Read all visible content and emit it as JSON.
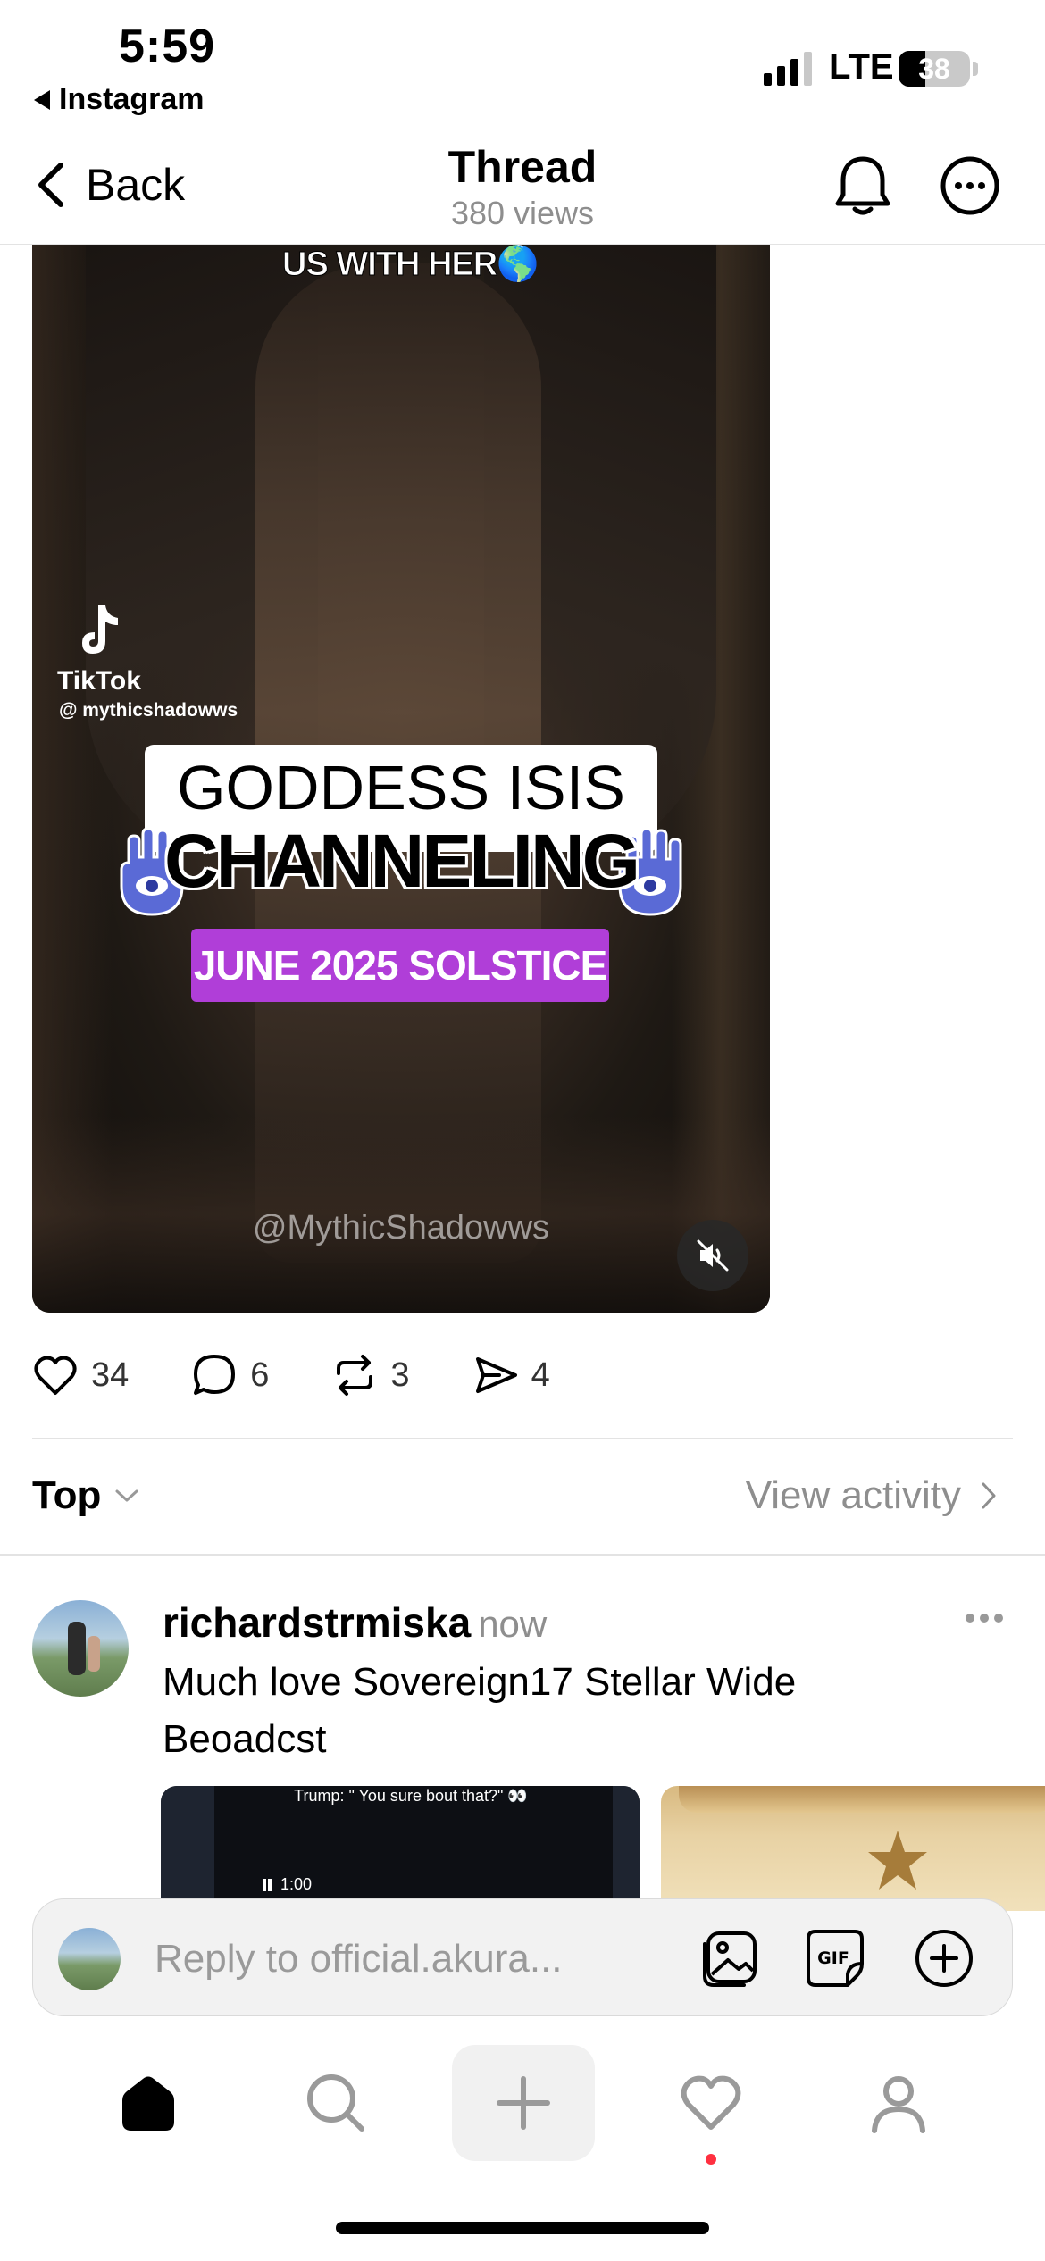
{
  "status_bar": {
    "time": "5:59",
    "back_app": "Instagram",
    "network": "LTE",
    "battery": "38",
    "battery_level": 0.38
  },
  "header": {
    "back_label": "Back",
    "title": "Thread",
    "subtitle": "380 views"
  },
  "video": {
    "top_caption": "US WITH HER🌎",
    "tiktok_name": "TikTok",
    "tiktok_handle": "@ mythicshadowws",
    "title_line1": "GODDESS ISIS",
    "title_line2": "CHANNELING",
    "badge": "JUNE 2025 SOLSTICE",
    "watermark": "@MythicShadowws",
    "badge_color": "#b03ed8"
  },
  "actions": {
    "likes": "34",
    "comments": "6",
    "reposts": "3",
    "shares": "4"
  },
  "sort": {
    "label": "Top",
    "view_activity": "View activity"
  },
  "comment": {
    "username": "richardstrmiska",
    "time": "now",
    "text": "Much love Sovereign17 Stellar Wide Beoadcst",
    "media_caption": "Trump: \" You sure bout that?\" 👀",
    "media_duration": "1:00"
  },
  "reply": {
    "placeholder": "Reply to official.akura..."
  },
  "tabbar": {
    "items": [
      "home",
      "search",
      "create",
      "activity",
      "profile"
    ],
    "notification_dot_color": "#ff3040"
  }
}
